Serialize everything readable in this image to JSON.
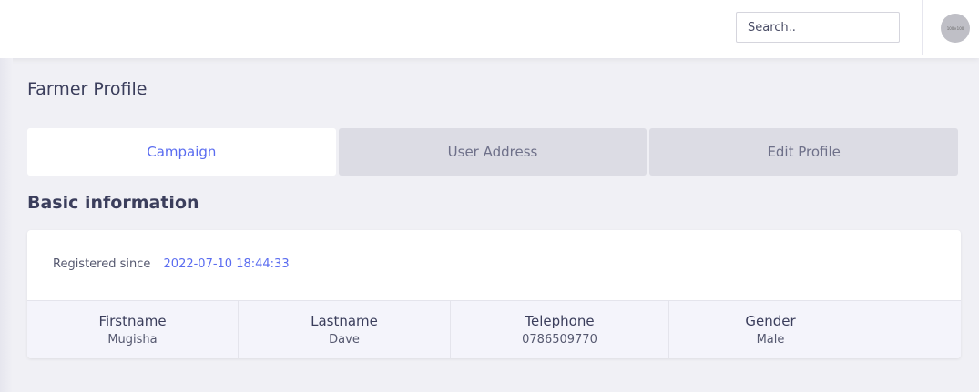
{
  "header": {
    "search_placeholder": "Search..",
    "avatar_text": "100×100"
  },
  "page": {
    "title": "Farmer Profile"
  },
  "tabs": [
    {
      "label": "Campaign",
      "active": true
    },
    {
      "label": "User Address",
      "active": false
    },
    {
      "label": "Edit Profile",
      "active": false
    }
  ],
  "basic_info": {
    "title": "Basic information",
    "registered_label": "Registered since",
    "registered_date": "2022-07-10 18:44:33",
    "fields": [
      {
        "label": "Firstname",
        "value": "Mugisha"
      },
      {
        "label": "Lastname",
        "value": "Dave"
      },
      {
        "label": "Telephone",
        "value": "0786509770"
      },
      {
        "label": "Gender",
        "value": "Male"
      }
    ]
  },
  "colors": {
    "accent": "#5a6cf0",
    "background": "#f0f0f5",
    "tab_inactive": "#dcdce4"
  }
}
